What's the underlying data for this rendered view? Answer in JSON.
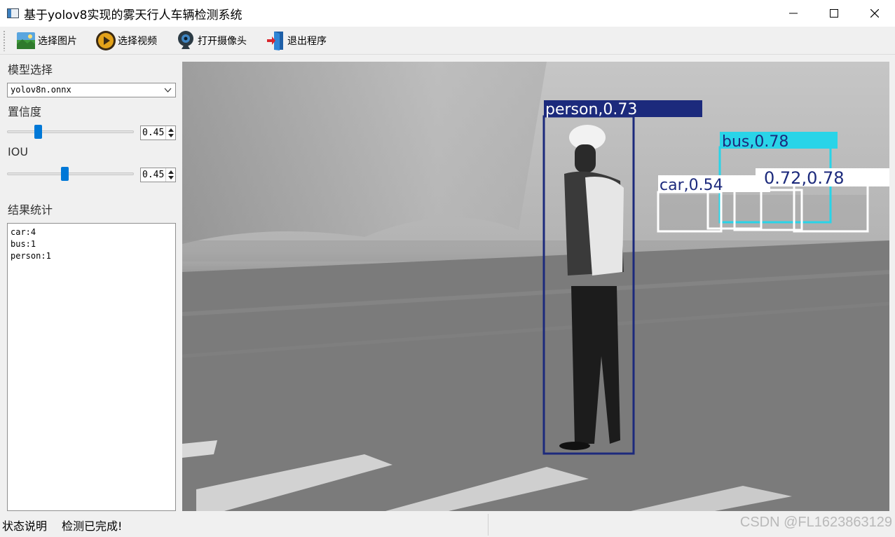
{
  "window": {
    "title": "基于yolov8实现的雾天行人车辆检测系统"
  },
  "toolbar": {
    "items": [
      {
        "label": "选择图片",
        "icon": "image-icon"
      },
      {
        "label": "选择视频",
        "icon": "play-icon"
      },
      {
        "label": "打开摄像头",
        "icon": "webcam-icon"
      },
      {
        "label": "退出程序",
        "icon": "exit-door-icon"
      }
    ]
  },
  "panel": {
    "model_title": "模型选择",
    "model_value": "yolov8n.onnx",
    "conf_title": "置信度",
    "conf_value": "0.45",
    "conf_slider_fraction": 0.23,
    "iou_title": "IOU",
    "iou_value": "0.45",
    "iou_slider_fraction": 0.45,
    "results_title": "结果统计",
    "results": [
      "car:4",
      "bus:1",
      "person:1"
    ]
  },
  "detections": {
    "person": "person,0.73",
    "bus": "bus,0.78",
    "car_a": "car,0.54",
    "car_b": "0.72,0.78"
  },
  "statusbar": {
    "label": "状态说明",
    "message": "检测已完成!",
    "watermark": "CSDN @FL1623863129"
  },
  "colors": {
    "person_box": "#1c2a7c",
    "bus_box": "#29d4e8",
    "car_box": "#ffffff",
    "slider_handle": "#0078d7"
  }
}
